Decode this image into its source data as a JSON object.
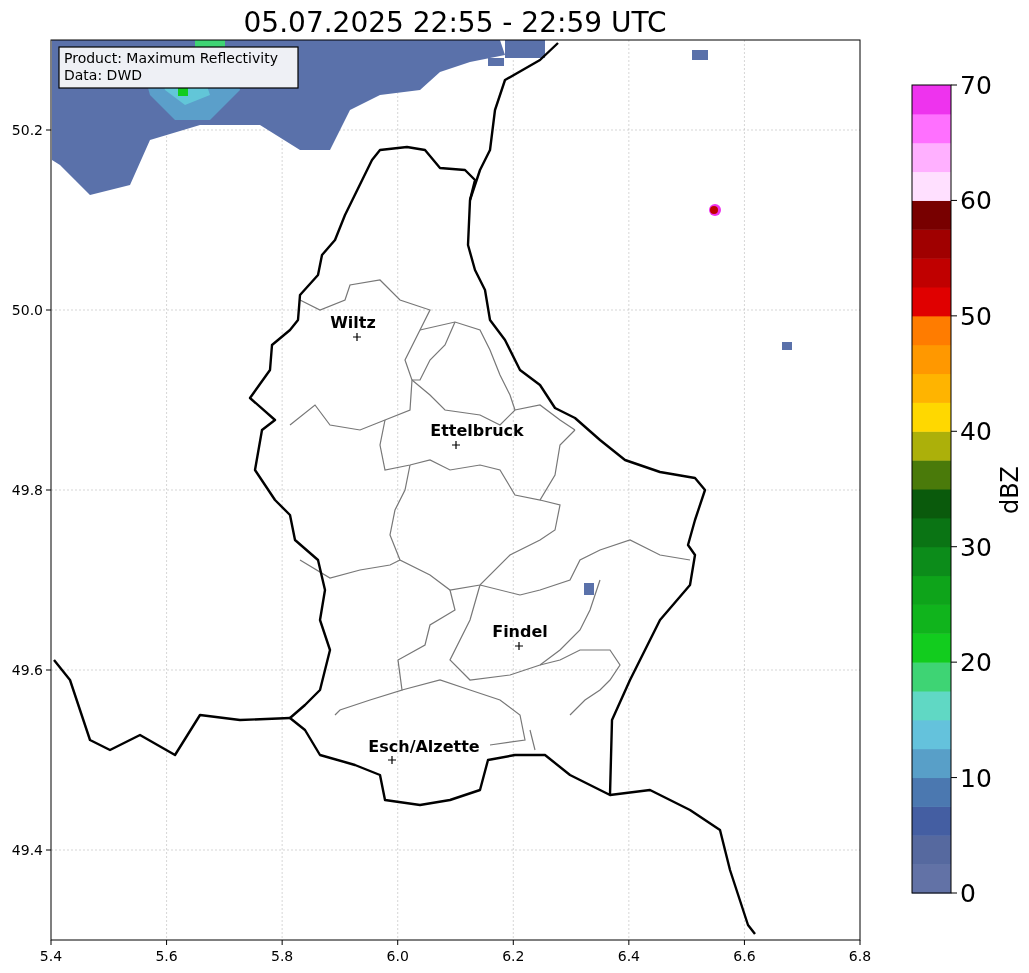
{
  "title": "05.07.2025 22:55 - 22:59 UTC",
  "legend": [
    "Product: Maximum Reflectivity",
    "Data: DWD"
  ],
  "map": {
    "xticks": [
      "5.4",
      "5.6",
      "5.8",
      "6.0",
      "6.2",
      "6.4",
      "6.6",
      "6.8"
    ],
    "yticks": [
      "50.2",
      "50.0",
      "49.8",
      "49.6",
      "49.4"
    ],
    "cities": [
      {
        "name": "Wiltz"
      },
      {
        "name": "Ettelbruck"
      },
      {
        "name": "Findel"
      },
      {
        "name": "Esch/Alzette"
      }
    ]
  },
  "colorbar": {
    "label": "dBZ",
    "ticks": [
      "70",
      "60",
      "50",
      "40",
      "30",
      "20",
      "10",
      "0"
    ],
    "bands": [
      {
        "color": "#6272a6"
      },
      {
        "color": "#56699f"
      },
      {
        "color": "#445ea2"
      },
      {
        "color": "#4b78b0"
      },
      {
        "color": "#589fc8"
      },
      {
        "color": "#64c2dc"
      },
      {
        "color": "#60d8c4"
      },
      {
        "color": "#3ed474"
      },
      {
        "color": "#12cc1e"
      },
      {
        "color": "#10b41c"
      },
      {
        "color": "#0ea41a"
      },
      {
        "color": "#0c8c1a"
      },
      {
        "color": "#0a7414"
      },
      {
        "color": "#0a5a0c"
      },
      {
        "color": "#4a7a0a"
      },
      {
        "color": "#acb00a"
      },
      {
        "color": "#ffd800"
      },
      {
        "color": "#ffb400"
      },
      {
        "color": "#ff9800"
      },
      {
        "color": "#ff7c00"
      },
      {
        "color": "#e00000"
      },
      {
        "color": "#c00000"
      },
      {
        "color": "#a00000"
      },
      {
        "color": "#780000"
      },
      {
        "color": "#ffe0ff"
      },
      {
        "color": "#ffb0ff"
      },
      {
        "color": "#ff70ff"
      },
      {
        "color": "#ee33ee"
      }
    ]
  }
}
